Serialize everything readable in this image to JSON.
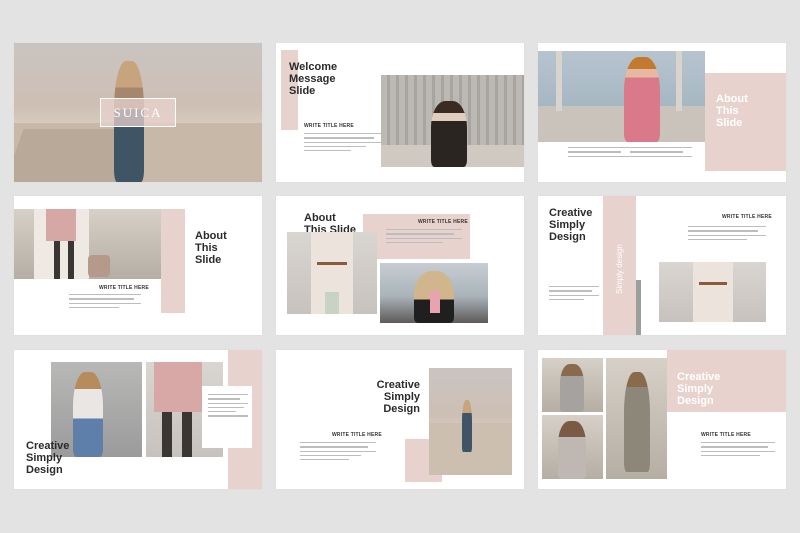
{
  "slides": [
    {
      "id": 1,
      "logo": "SUICA"
    },
    {
      "id": 2,
      "title_lines": [
        "Welcome",
        "Message",
        "Slide"
      ],
      "subtitle": "WRITE TITLE HERE"
    },
    {
      "id": 3,
      "title_lines": [
        "About",
        "This",
        "Slide"
      ]
    },
    {
      "id": 4,
      "title_lines": [
        "About",
        "This",
        "Slide"
      ],
      "subtitle": "WRITE TITLE HERE"
    },
    {
      "id": 5,
      "title_lines": [
        "About",
        "This Slide"
      ],
      "subtitle": "WRITE TITLE HERE"
    },
    {
      "id": 6,
      "title_lines": [
        "Creative",
        "Simply",
        "Design"
      ],
      "subtitle": "WRITE TITLE HERE",
      "vertical_text": "Simply design"
    },
    {
      "id": 7,
      "title_lines": [
        "Creative",
        "Simply",
        "Design"
      ]
    },
    {
      "id": 8,
      "title_lines": [
        "Creative",
        "Simply",
        "Design"
      ],
      "subtitle": "WRITE TITLE HERE"
    },
    {
      "id": 9,
      "title_lines": [
        "Creative",
        "Simply",
        "Design"
      ],
      "subtitle": "WRITE TITLE HERE"
    }
  ],
  "colors": {
    "accent": "#e8d2cd",
    "background": "#e3e3e3",
    "heading": "#2b2b2b"
  }
}
